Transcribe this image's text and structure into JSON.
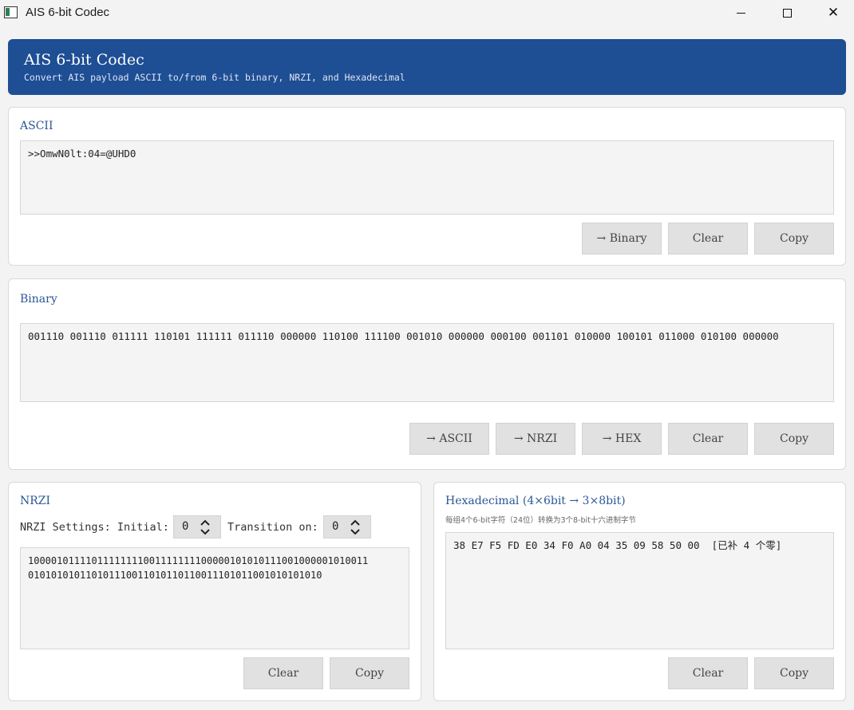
{
  "window": {
    "title": "AIS 6-bit Codec",
    "icons": {
      "app": "app-icon",
      "minimize": "minimize-icon",
      "maximize": "maximize-icon",
      "close": "close-icon"
    }
  },
  "header": {
    "title": "AIS 6-bit Codec",
    "subtitle": "Convert AIS payload ASCII to/from 6-bit binary, NRZI, and Hexadecimal",
    "color": "#1e4e94"
  },
  "ascii": {
    "title": "ASCII",
    "value": ">>OmwN0lt:04=@UHD0",
    "buttons": {
      "to_binary": "→ Binary",
      "clear": "Clear",
      "copy": "Copy"
    }
  },
  "binary": {
    "title": "Binary",
    "value": "001110 001110 011111 110101 111111 011110 000000 110100 111100 001010 000000 000100 001101 010000 100101 011000 010100 000000",
    "buttons": {
      "to_ascii": "→ ASCII",
      "to_nrzi": "→ NRZI",
      "to_hex": "→ HEX",
      "clear": "Clear",
      "copy": "Copy"
    }
  },
  "nrzi": {
    "title": "NRZI",
    "settings_label": "NRZI Settings: Initial:",
    "initial": "0",
    "transition_label": "Transition on:",
    "transition": "0",
    "value": "10000101111011111111001111111100000101010111001000001010011\n010101010110101110011010110110011101011001010101010",
    "buttons": {
      "clear": "Clear",
      "copy": "Copy"
    }
  },
  "hex": {
    "title": "Hexadecimal (4×6bit → 3×8bit)",
    "note": "每组4个6-bit字符（24位）转换为3个8-bit十六进制字节",
    "value": "38 E7 F5 FD E0 34 F0 A0 04 35 09 58 50 00  [已补 4 个零]",
    "buttons": {
      "clear": "Clear",
      "copy": "Copy"
    }
  }
}
